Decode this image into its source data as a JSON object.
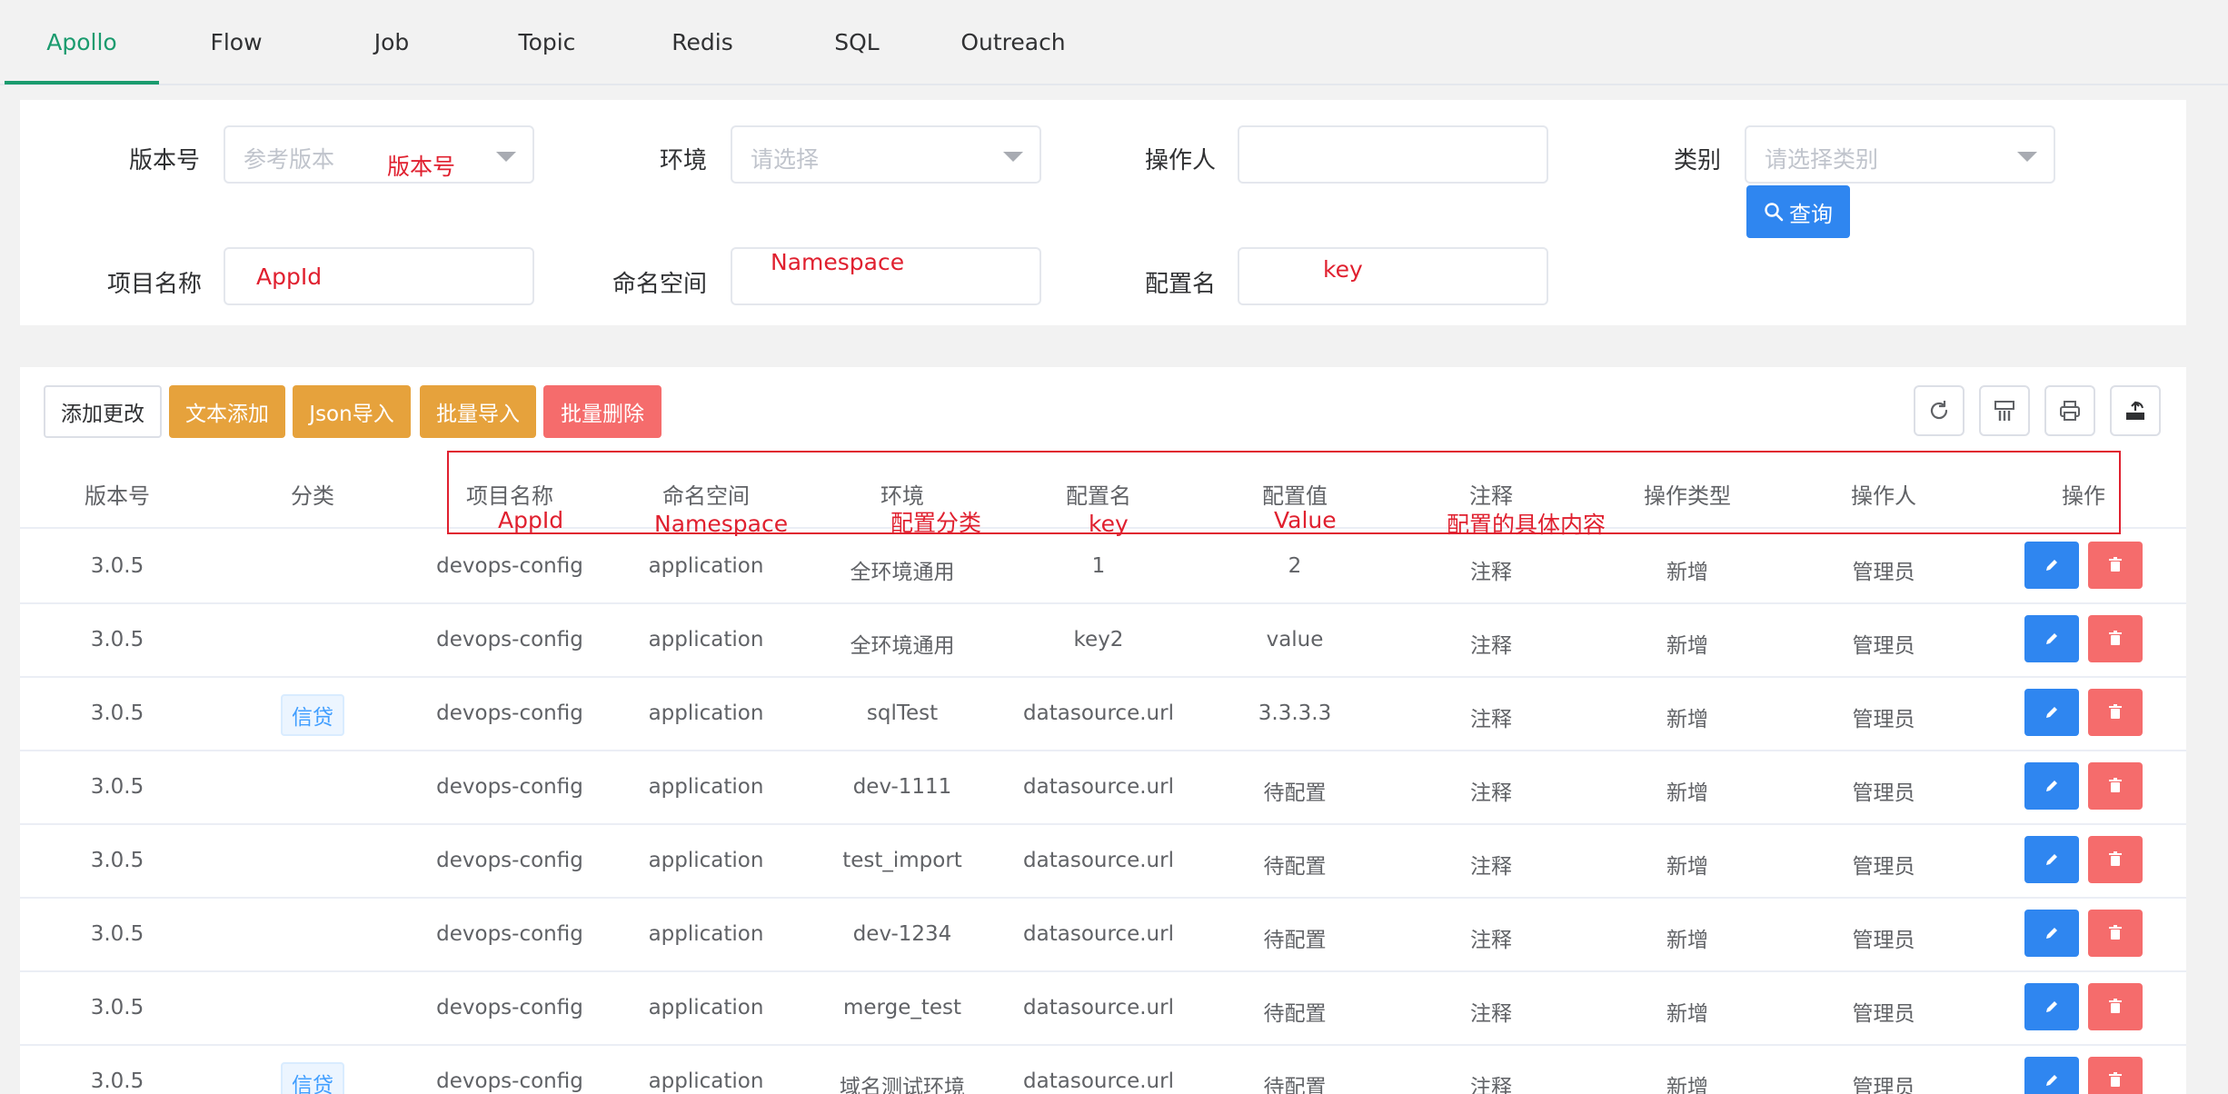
{
  "tabs": [
    {
      "label": "Apollo",
      "active": true
    },
    {
      "label": "Flow",
      "active": false
    },
    {
      "label": "Job",
      "active": false
    },
    {
      "label": "Topic",
      "active": false
    },
    {
      "label": "Redis",
      "active": false
    },
    {
      "label": "SQL",
      "active": false
    },
    {
      "label": "Outreach",
      "active": false
    }
  ],
  "search": {
    "version_label": "版本号",
    "version_placeholder": "参考版本",
    "env_label": "环境",
    "env_placeholder": "请选择",
    "operator_label": "操作人",
    "category_label": "类别",
    "category_placeholder": "请选择类别",
    "project_label": "项目名称",
    "namespace_label": "命名空间",
    "config_label": "配置名",
    "query_label": "查询"
  },
  "annotations": {
    "version": "版本号",
    "appid": "AppId",
    "namespace": "Namespace",
    "key": "key",
    "h_appid": "AppId",
    "h_namespace": "Namespace",
    "h_env": "配置分类",
    "h_key": "key",
    "h_value": "Value",
    "h_comment": "配置的具体内容"
  },
  "toolbar": {
    "add_change": "添加更改",
    "text_add": "文本添加",
    "json_import": "Json导入",
    "batch_import": "批量导入",
    "batch_delete": "批量删除"
  },
  "table": {
    "headers": [
      "版本号",
      "分类",
      "项目名称",
      "命名空间",
      "环境",
      "配置名",
      "配置值",
      "注释",
      "操作类型",
      "操作人",
      "操作"
    ],
    "rows": [
      [
        "3.0.5",
        "",
        "devops-config",
        "application",
        "全环境通用",
        "1",
        "2",
        "注释",
        "新增",
        "管理员"
      ],
      [
        "3.0.5",
        "",
        "devops-config",
        "application",
        "全环境通用",
        "key2",
        "value",
        "注释",
        "新增",
        "管理员"
      ],
      [
        "3.0.5",
        "信贷",
        "devops-config",
        "application",
        "sqlTest",
        "datasource.url",
        "3.3.3.3",
        "注释",
        "新增",
        "管理员"
      ],
      [
        "3.0.5",
        "",
        "devops-config",
        "application",
        "dev-1111",
        "datasource.url",
        "待配置",
        "注释",
        "新增",
        "管理员"
      ],
      [
        "3.0.5",
        "",
        "devops-config",
        "application",
        "test_import",
        "datasource.url",
        "待配置",
        "注释",
        "新增",
        "管理员"
      ],
      [
        "3.0.5",
        "",
        "devops-config",
        "application",
        "dev-1234",
        "datasource.url",
        "待配置",
        "注释",
        "新增",
        "管理员"
      ],
      [
        "3.0.5",
        "",
        "devops-config",
        "application",
        "merge_test",
        "datasource.url",
        "待配置",
        "注释",
        "新增",
        "管理员"
      ],
      [
        "3.0.5",
        "信贷",
        "devops-config",
        "application",
        "域名测试环境",
        "datasource.url",
        "待配置",
        "注释",
        "新增",
        "管理员"
      ]
    ]
  },
  "colors": {
    "active_tab": "#1a9b6e",
    "primary": "#2f86f0",
    "warning": "#e6a23c",
    "danger": "#f56c6c",
    "annotation": "#e0202f"
  }
}
